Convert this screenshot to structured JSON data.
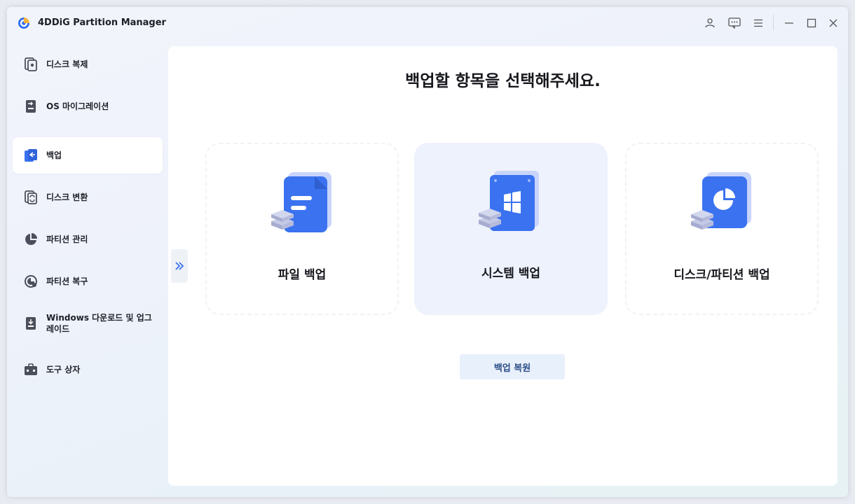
{
  "app": {
    "title": "4DDiG Partition Manager"
  },
  "titlebar": {
    "icons": [
      "user-icon",
      "feedback-icon",
      "menu-icon",
      "minimize-icon",
      "maximize-icon",
      "close-icon"
    ]
  },
  "sidebar": {
    "items": [
      {
        "label": "디스크 복제",
        "icon": "disk-clone-icon"
      },
      {
        "label": "OS 마이그레이션",
        "icon": "os-migration-icon"
      },
      {
        "label": "백업",
        "icon": "backup-icon",
        "active": true
      },
      {
        "label": "디스크 변환",
        "icon": "disk-convert-icon"
      },
      {
        "label": "파티션 관리",
        "icon": "partition-manage-icon"
      },
      {
        "label": "파티션 복구",
        "icon": "partition-recover-icon"
      },
      {
        "label": "Windows 다운로드 및 업그레이드",
        "icon": "windows-download-icon"
      },
      {
        "label": "도구 상자",
        "icon": "toolbox-icon"
      }
    ]
  },
  "main": {
    "title": "백업할 항목을 선택해주세요.",
    "cards": [
      {
        "label": "파일 백업",
        "icon": "file-backup-icon"
      },
      {
        "label": "시스템 백업",
        "icon": "system-backup-icon"
      },
      {
        "label": "디스크/파티션 백업",
        "icon": "disk-partition-backup-icon"
      }
    ],
    "restore_button": "백업 복원"
  },
  "colors": {
    "accent": "#3a72f0",
    "sidebar_icon": "#4b4f5c",
    "restore_bg": "#e8f0fc"
  }
}
